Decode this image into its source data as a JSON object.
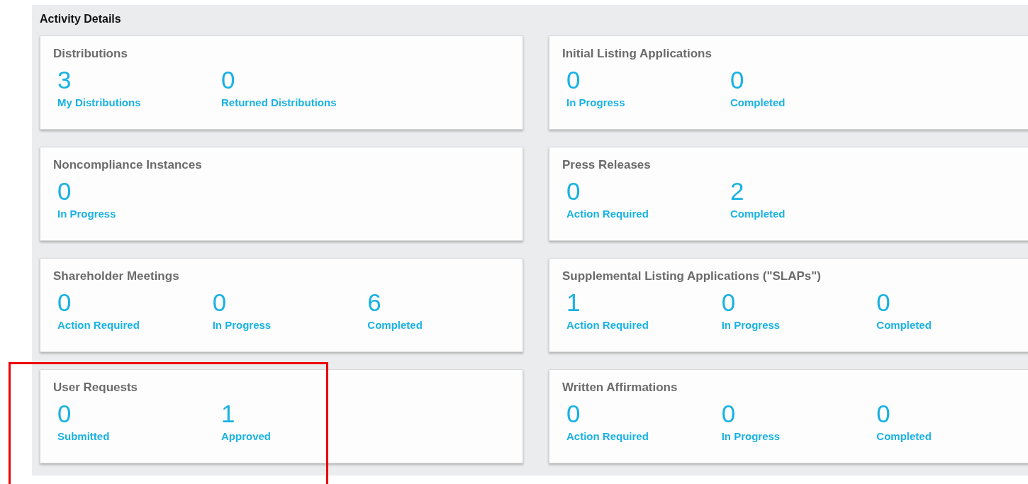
{
  "panel": {
    "title": "Activity Details"
  },
  "cards": [
    {
      "title": "Distributions",
      "highlighted": false,
      "stats": [
        {
          "value": "3",
          "label": "My Distributions"
        },
        {
          "value": "0",
          "label": "Returned Distributions"
        }
      ]
    },
    {
      "title": "Initial Listing Applications",
      "highlighted": false,
      "stats": [
        {
          "value": "0",
          "label": "In Progress"
        },
        {
          "value": "0",
          "label": "Completed"
        }
      ]
    },
    {
      "title": "Noncompliance Instances",
      "highlighted": false,
      "stats": [
        {
          "value": "0",
          "label": "In Progress"
        }
      ]
    },
    {
      "title": "Press Releases",
      "highlighted": false,
      "stats": [
        {
          "value": "0",
          "label": "Action Required"
        },
        {
          "value": "2",
          "label": "Completed"
        }
      ]
    },
    {
      "title": "Shareholder Meetings",
      "highlighted": false,
      "stats": [
        {
          "value": "0",
          "label": "Action Required"
        },
        {
          "value": "0",
          "label": "In Progress"
        },
        {
          "value": "6",
          "label": "Completed"
        }
      ]
    },
    {
      "title": "Supplemental Listing Applications (\"SLAPs\")",
      "highlighted": false,
      "stats": [
        {
          "value": "1",
          "label": "Action Required"
        },
        {
          "value": "0",
          "label": "In Progress"
        },
        {
          "value": "0",
          "label": "Completed"
        }
      ]
    },
    {
      "title": "User Requests",
      "highlighted": true,
      "stats": [
        {
          "value": "0",
          "label": "Submitted"
        },
        {
          "value": "1",
          "label": "Approved"
        }
      ]
    },
    {
      "title": "Written Affirmations",
      "highlighted": false,
      "stats": [
        {
          "value": "0",
          "label": "Action Required"
        },
        {
          "value": "0",
          "label": "In Progress"
        },
        {
          "value": "0",
          "label": "Completed"
        }
      ]
    }
  ]
}
